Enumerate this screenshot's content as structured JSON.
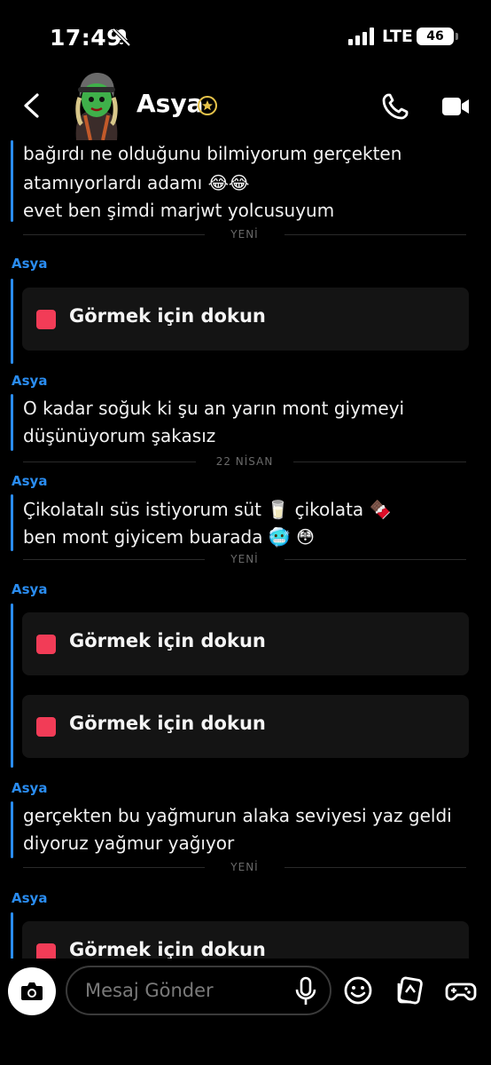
{
  "status_bar": {
    "time": "17:49",
    "network": "LTE",
    "battery": "46"
  },
  "header": {
    "contact_name": "Asya"
  },
  "messages": {
    "block1": {
      "line1": "bağırdı ne olduğunu bilmiyorum gerçekten",
      "line2": "atamıyorlardı adamı 😂😂",
      "line3": "evet ben şimdi marjwt yolcusuyum"
    },
    "divider1": "YENİ",
    "sender1": "Asya",
    "snap1": "Görmek için dokun",
    "sender2": "Asya",
    "block2": {
      "line1": "O kadar soğuk ki şu an yarın mont giymeyi",
      "line2": "düşünüyorum şakasız"
    },
    "divider2": "22 NİSAN",
    "sender3": "Asya",
    "block3": {
      "line1": "Çikolatalı süs istiyorum süt 🥛 çikolata 🍫",
      "line2": "ben mont giyicem buarada 🥶 😳"
    },
    "divider3": "YENİ",
    "sender4": "Asya",
    "snap2": "Görmek için dokun",
    "snap3": "Görmek için dokun",
    "sender5": "Asya",
    "block4": {
      "line1": "gerçekten bu yağmurun alaka seviyesi yaz geldi",
      "line2": "diyoruz yağmur yağıyor"
    },
    "divider4": "YENİ",
    "sender6": "Asya",
    "snap4": "Görmek için dokun"
  },
  "input": {
    "placeholder": "Mesaj Gönder"
  },
  "colors": {
    "accent_blue": "#2a8cf0",
    "snap_red": "#f23c57",
    "background": "#000000"
  },
  "icons": [
    "bell-slash-icon",
    "signal-icon",
    "back-chevron-icon",
    "star-badge-icon",
    "phone-icon",
    "video-icon",
    "camera-icon",
    "microphone-icon",
    "emoji-icon",
    "stickers-icon",
    "games-icon"
  ]
}
